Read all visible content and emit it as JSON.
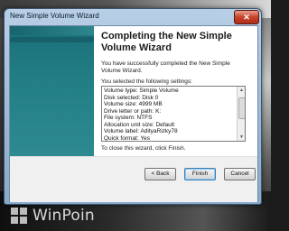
{
  "window": {
    "title": "New Simple Volume Wizard",
    "close_glyph": "✕"
  },
  "wizard": {
    "heading": "Completing the New Simple Volume Wizard",
    "completed_message": "You have successfully completed the New Simple Volume Wizard.",
    "settings_label": "You selected the following settings:",
    "settings": [
      "Volume type: Simple Volume",
      "Disk selected: Disk 0",
      "Volume size: 4999 MB",
      "Drive letter or path: K:",
      "File system: NTFS",
      "Allocation unit size: Default",
      "Volume label: AdityaRizky78",
      "Quick format: Yes"
    ],
    "close_instruction": "To close this wizard, click Finish."
  },
  "buttons": {
    "back": "< Back",
    "finish": "Finish",
    "cancel": "Cancel"
  },
  "watermark": {
    "text": "WinPoin"
  },
  "colors": {
    "side_panel": "#237f86",
    "close_button": "#c7422a"
  }
}
